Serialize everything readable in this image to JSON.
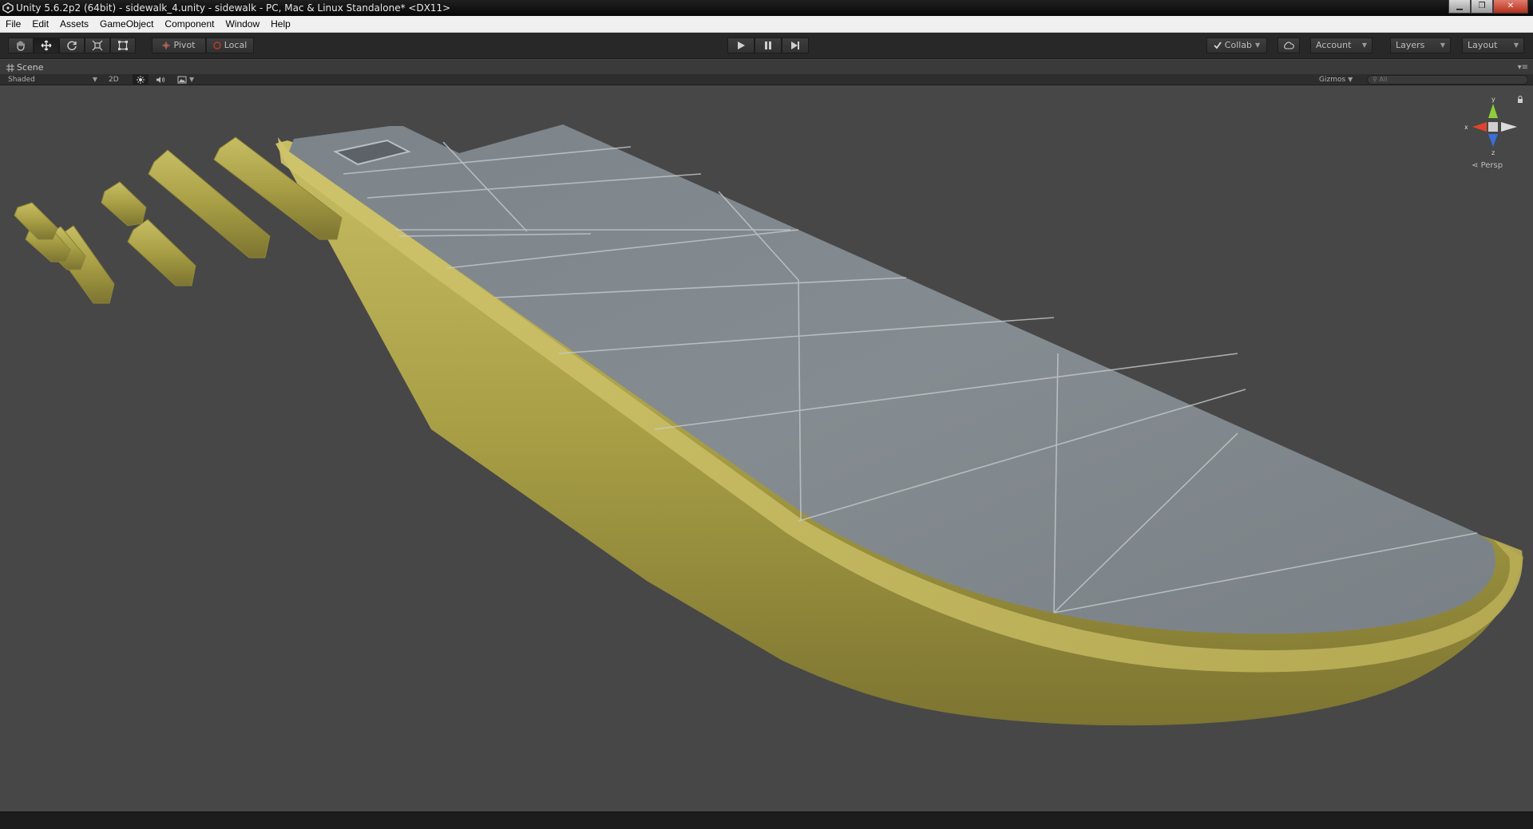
{
  "window": {
    "title": "Unity 5.6.2p2 (64bit) - sidewalk_4.unity - sidewalk - PC, Mac & Linux Standalone* <DX11>",
    "controls": [
      "minimize",
      "maximize",
      "close"
    ]
  },
  "menu": {
    "items": [
      "File",
      "Edit",
      "Assets",
      "GameObject",
      "Component",
      "Window",
      "Help"
    ]
  },
  "toolbar": {
    "transform_tools": [
      "hand-icon",
      "move-icon",
      "rotate-icon",
      "scale-icon",
      "rect-icon"
    ],
    "active_tool": "move-icon",
    "pivot_label": "Pivot",
    "space_label": "Local",
    "playback": [
      "play-icon",
      "pause-icon",
      "step-icon"
    ],
    "collab_label": "Collab",
    "account_label": "Account",
    "layers_label": "Layers",
    "layout_label": "Layout"
  },
  "scene_panel": {
    "tab_label": "Scene",
    "draw_mode": "Shaded",
    "mode_2d": "2D",
    "gizmos_label": "Gizmos",
    "search_placeholder": "All",
    "gizmo_axes": {
      "y": "y",
      "x": "x",
      "z": "z"
    },
    "projection": "Persp"
  },
  "colors": {
    "viewport_bg": "#474747",
    "concrete": "#7d858a",
    "curb_yellow": "#b8ad52",
    "axis_x": "#e0442a",
    "axis_y": "#8ccf3a",
    "axis_z": "#3a6fd8"
  }
}
